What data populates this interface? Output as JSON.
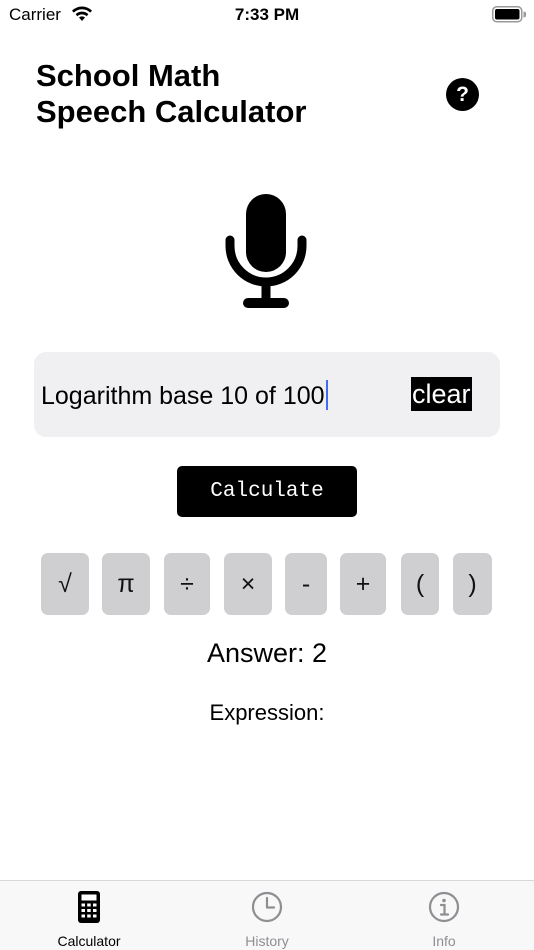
{
  "status_bar": {
    "carrier": "Carrier",
    "time": "7:33 PM"
  },
  "header": {
    "title_line1": "School Math",
    "title_line2": "Speech Calculator",
    "help_label": "?"
  },
  "input": {
    "value": "Logarithm base 10 of 100",
    "clear_label": "clear"
  },
  "calculate_label": "Calculate",
  "operators": [
    "√",
    "π",
    "÷",
    "×",
    "-",
    "+",
    "(",
    ")"
  ],
  "answer": "Answer: 2",
  "expression": "Expression:",
  "tabs": [
    {
      "label": "Calculator",
      "active": true
    },
    {
      "label": "History",
      "active": false
    },
    {
      "label": "Info",
      "active": false
    }
  ],
  "colors": {
    "accent": "#000000",
    "caret": "#3f6cf0",
    "key_bg": "#cfcfd1",
    "input_bg": "#f0f0f2",
    "inactive_tab": "#8e8e93"
  }
}
